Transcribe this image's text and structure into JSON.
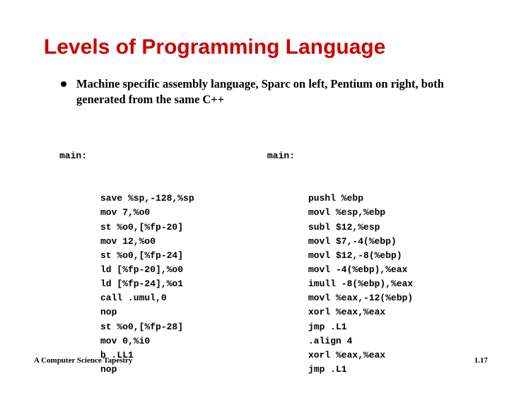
{
  "title": "Levels of Programming Language",
  "bullet": "Machine specific assembly language, Sparc on left, Pentium on right, both generated from the same C++",
  "code": {
    "left_label": "main:",
    "left_body": "save %sp,-128,%sp\nmov 7,%o0\nst %o0,[%fp-20]\nmov 12,%o0\nst %o0,[%fp-24]\nld [%fp-20],%o0\nld [%fp-24],%o1\ncall .umul,0\nnop\nst %o0,[%fp-28]\nmov 0,%i0\nb .LL1\nnop",
    "right_label": "main:",
    "right_body": "pushl %ebp\nmovl %esp,%ebp\nsubl $12,%esp\nmovl $7,-4(%ebp)\nmovl $12,-8(%ebp)\nmovl -4(%ebp),%eax\nimull -8(%ebp),%eax\nmovl %eax,-12(%ebp)\nxorl %eax,%eax\njmp .L1\n.align 4\nxorl %eax,%eax\njmp .L1"
  },
  "footer": {
    "left": "A Computer Science Tapestry",
    "right": "1.17"
  }
}
